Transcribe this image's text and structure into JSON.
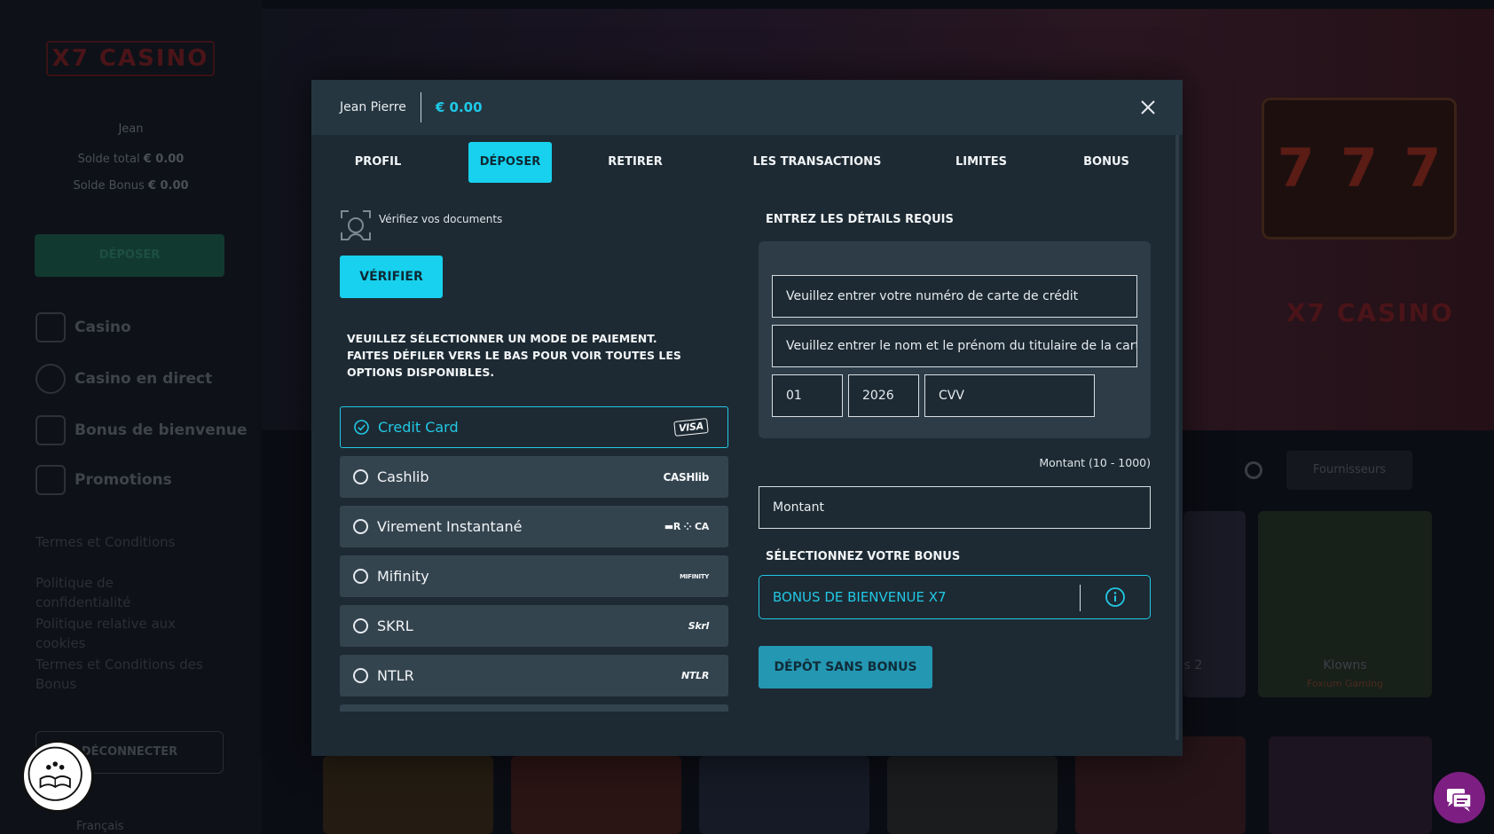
{
  "background": {
    "logo": "X7 CASINO",
    "user": {
      "name": "Jean",
      "total_label": "Solde total",
      "total_value": "€ 0.00",
      "bonus_label": "Solde Bonus",
      "bonus_value": "€ 0.00"
    },
    "deposit_label": "DÉPOSER",
    "nav": [
      "Casino",
      "Casino en direct",
      "Bonus de bienvenue",
      "Promotions"
    ],
    "links": [
      "Termes et Conditions",
      "Politique de confidentialité",
      "Politique relative aux cookies",
      "Termes et Conditions des Bonus"
    ],
    "logout_label": "DÉCONNECTER",
    "language": "Français",
    "provider_placeholder": "Fournisseurs",
    "slot_symbols": [
      "7",
      "7",
      "7"
    ],
    "tiles_top": [
      "s 2",
      "Klowns"
    ],
    "tile_sub": "Foxium Gaming"
  },
  "modal": {
    "user_name": "Jean Pierre",
    "balance": "€ 0.00",
    "tabs": [
      "PROFIL",
      "DÉPOSER",
      "RETIRER",
      "LES TRANSACTIONS",
      "LIMITES",
      "BONUS"
    ],
    "active_tab": "DÉPOSER",
    "verify_text": "Vérifiez vos documents",
    "verify_button": "VÉRIFIER",
    "payment_instructions": "VEUILLEZ SÉLECTIONNER UN MODE DE PAIEMENT. FAITES DÉFILER VERS LE BAS POUR VOIR TOUTES LES OPTIONS DISPONIBLES.",
    "payment_methods": [
      {
        "label": "Credit Card",
        "logo": "VISA",
        "selected": true
      },
      {
        "label": "Cashlib",
        "logo": "CASHlib",
        "selected": false
      },
      {
        "label": "Virement Instantané",
        "logo": "▬R ⁘ CA",
        "selected": false
      },
      {
        "label": "Mifinity",
        "logo": "MIFINITY",
        "selected": false
      },
      {
        "label": "SKRL",
        "logo": "Skrl",
        "selected": false
      },
      {
        "label": "NTLR",
        "logo": "NTLR",
        "selected": false
      }
    ],
    "details_title": "ENTREZ LES DÉTAILS REQUIS",
    "card_number_placeholder": "Veuillez entrer votre numéro de carte de crédit",
    "card_holder_placeholder": "Veuillez entrer le nom et le prénom du titulaire de la carte",
    "exp_month": "01",
    "exp_year": "2026",
    "cvv_placeholder": "CVV",
    "amount_label": "Montant (10 - 1000)",
    "amount_placeholder": "Montant",
    "bonus_title": "SÉLECTIONNEZ VOTRE BONUS",
    "bonus_selected": "BONUS DE BIENVENUE X7",
    "no_bonus_button": "DÉPÔT SANS BONUS"
  },
  "colors": {
    "accent": "#17d1ee",
    "modal_bg": "#1d2a33",
    "header_bg": "#263640",
    "chat": "#7d1f82"
  }
}
